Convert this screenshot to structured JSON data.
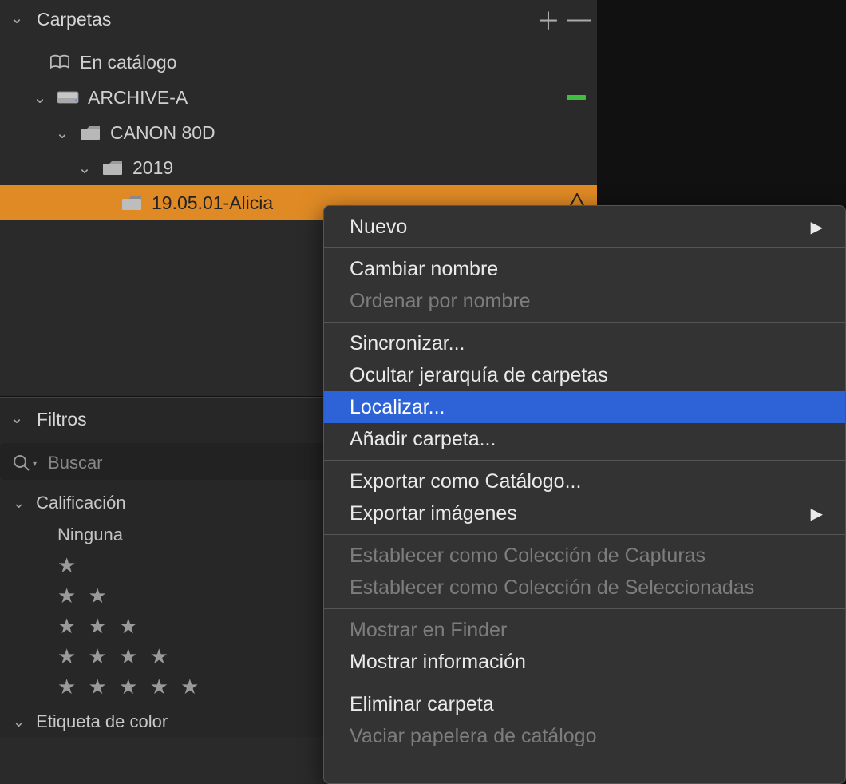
{
  "panels": {
    "carpetas": {
      "title": "Carpetas",
      "items": [
        {
          "label": "En catálogo",
          "depth": 0,
          "icon": "book",
          "chevron": false
        },
        {
          "label": "ARCHIVE-A",
          "depth": 1,
          "icon": "drive",
          "chevron": true,
          "status": "green"
        },
        {
          "label": "CANON 80D",
          "depth": 2,
          "icon": "folder",
          "chevron": true
        },
        {
          "label": "2019",
          "depth": 3,
          "icon": "folder",
          "chevron": true
        },
        {
          "label": "19.05.01-Alicia",
          "depth": 4,
          "icon": "folder",
          "chevron": false,
          "selected": true,
          "status": "warning"
        }
      ]
    },
    "filtros": {
      "title": "Filtros",
      "search_placeholder": "Buscar",
      "rating": {
        "header": "Calificación",
        "none_label": "Ninguna"
      },
      "color_tag": {
        "header": "Etiqueta de color"
      }
    }
  },
  "context_menu": {
    "items": [
      {
        "label": "Nuevo",
        "submenu": true
      },
      {
        "sep": true
      },
      {
        "label": "Cambiar nombre"
      },
      {
        "label": "Ordenar por nombre",
        "disabled": true
      },
      {
        "sep": true
      },
      {
        "label": "Sincronizar..."
      },
      {
        "label": "Ocultar jerarquía de carpetas"
      },
      {
        "label": "Localizar...",
        "highlight": true
      },
      {
        "label": "Añadir carpeta..."
      },
      {
        "sep": true
      },
      {
        "label": "Exportar como Catálogo..."
      },
      {
        "label": "Exportar imágenes",
        "submenu": true
      },
      {
        "sep": true
      },
      {
        "label": "Establecer como Colección de Capturas",
        "disabled": true
      },
      {
        "label": "Establecer como Colección de Seleccionadas",
        "disabled": true
      },
      {
        "sep": true
      },
      {
        "label": "Mostrar en Finder",
        "disabled": true
      },
      {
        "label": "Mostrar información"
      },
      {
        "sep": true
      },
      {
        "label": "Eliminar carpeta"
      },
      {
        "label": "Vaciar papelera de catálogo",
        "disabled": true
      }
    ]
  }
}
